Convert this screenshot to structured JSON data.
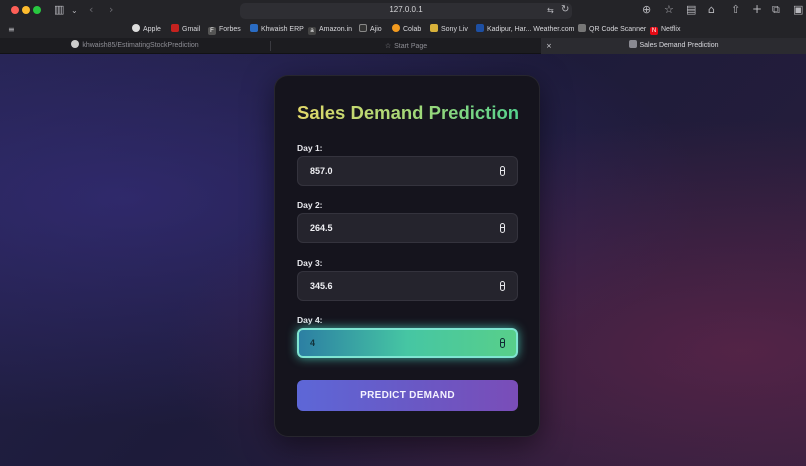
{
  "browser": {
    "url": "127.0.0.1",
    "bookmarks": [
      {
        "label": "Apple",
        "icon": "apple-icon"
      },
      {
        "label": "Gmail",
        "icon": "gmail-icon"
      },
      {
        "label": "Forbes",
        "icon": "forbes-icon"
      },
      {
        "label": "Khwaish ERP",
        "icon": "erp-icon"
      },
      {
        "label": "Amazon.in",
        "icon": "amazon-icon"
      },
      {
        "label": "Ajio",
        "icon": "ajio-icon"
      },
      {
        "label": "Colab",
        "icon": "colab-icon"
      },
      {
        "label": "Sony Liv",
        "icon": "sonyliv-icon"
      },
      {
        "label": "Kadipur, Har... Weather.com",
        "icon": "weather-icon"
      },
      {
        "label": "QR Code Scanner",
        "icon": "qr-icon"
      },
      {
        "label": "Netflix",
        "icon": "netflix-icon"
      }
    ],
    "tabs": [
      {
        "label": "khwaish85/EstimatingStockPrediction",
        "icon": "github-icon",
        "active": false
      },
      {
        "label": "Start Page",
        "icon": "star-icon",
        "active": false
      },
      {
        "label": "Sales Demand Prediction",
        "icon": "page-icon",
        "active": true
      }
    ]
  },
  "app": {
    "title": "Sales Demand Prediction",
    "fields": [
      {
        "label": "Day 1:",
        "value": "857.0",
        "focused": false
      },
      {
        "label": "Day 2:",
        "value": "264.5",
        "focused": false
      },
      {
        "label": "Day 3:",
        "value": "345.6",
        "focused": false
      },
      {
        "label": "Day 4:",
        "value": "4",
        "focused": true
      }
    ],
    "predict_button": "PREDICT DEMAND"
  },
  "colors": {
    "title_gradient": [
      "#e2d86a",
      "#55d28e"
    ],
    "button_gradient": [
      "#5d67d7",
      "#7a4db8"
    ],
    "focused_field": "#46c6a3"
  }
}
